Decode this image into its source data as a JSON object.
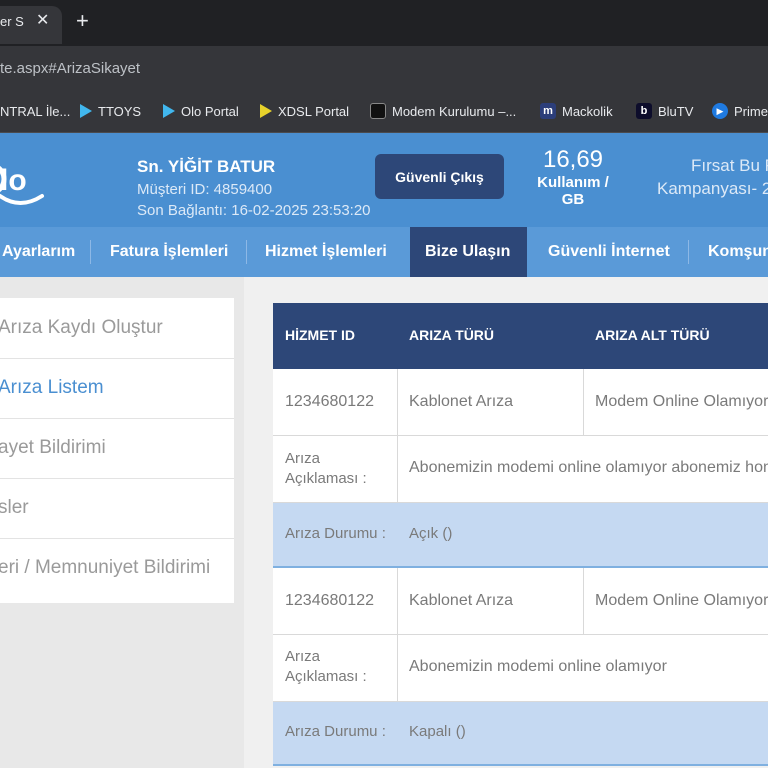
{
  "browser": {
    "tab_title": "er S",
    "tab_close": "✕",
    "new_tab": "+",
    "url": "te.aspx#ArizaSikayet",
    "bookmarks": [
      {
        "label": "NTRAL İle...",
        "icon": "none"
      },
      {
        "label": "TTOYS",
        "icon": "triangle-blue"
      },
      {
        "label": "Olo Portal",
        "icon": "triangle-blue"
      },
      {
        "label": "XDSL Portal",
        "icon": "triangle-yellow"
      },
      {
        "label": "Modem Kurulumu –...",
        "icon": "u-icon"
      },
      {
        "label": "Mackolik",
        "icon": "m-icon"
      },
      {
        "label": "BluTV",
        "icon": "b-icon"
      },
      {
        "label": "Prime",
        "icon": "play-icon"
      }
    ]
  },
  "header": {
    "user_name": "Sn. YİĞİT BATUR",
    "customer_id": "Müşteri ID: 4859400",
    "last_connection": "Son Bağlantı: 16-02-2025 23:53:20",
    "logout_label": "Güvenli Çıkış",
    "usage_value": "16,69",
    "usage_label": "Kullanım / GB",
    "promo_line1": "Fırsat Bu F",
    "promo_line2": "Kampanyası- 2",
    "brand_color": "#4a8fd1",
    "dark_color": "#2d4778"
  },
  "nav": {
    "items": [
      "Ayarlarım",
      "Fatura İşlemleri",
      "Hizmet İşlemleri",
      "Bize Ulaşın",
      "Güvenli İnternet",
      "Komşun"
    ],
    "active": "Bize Ulaşın"
  },
  "sidebar": {
    "items": [
      {
        "label": "Arıza Kaydı Oluştur",
        "active": false
      },
      {
        "label": "Arıza Listem",
        "active": true
      },
      {
        "label": "ayet Bildirimi",
        "active": false
      },
      {
        "label": "sler",
        "active": false
      },
      {
        "label": "eri / Memnuniyet Bildirimi",
        "active": false
      }
    ]
  },
  "table": {
    "headers": [
      "HİZMET ID",
      "ARIZA TÜRÜ",
      "ARIZA ALT TÜRÜ"
    ],
    "description_label_1": "Arıza",
    "description_label_2": "Açıklaması :",
    "status_label": "Arıza Durumu :",
    "records": [
      {
        "service_id": "1234680122",
        "fault_type": "Kablonet Arıza",
        "fault_subtype": "Modem Online Olamıyor",
        "description": "Abonemizin modemi online olamıyor abonemiz homec",
        "status": "Açık ()"
      },
      {
        "service_id": "1234680122",
        "fault_type": "Kablonet Arıza",
        "fault_subtype": "Modem Online Olamıyor",
        "description": "Abonemizin modemi online olamıyor",
        "status": "Kapalı ()"
      }
    ]
  }
}
